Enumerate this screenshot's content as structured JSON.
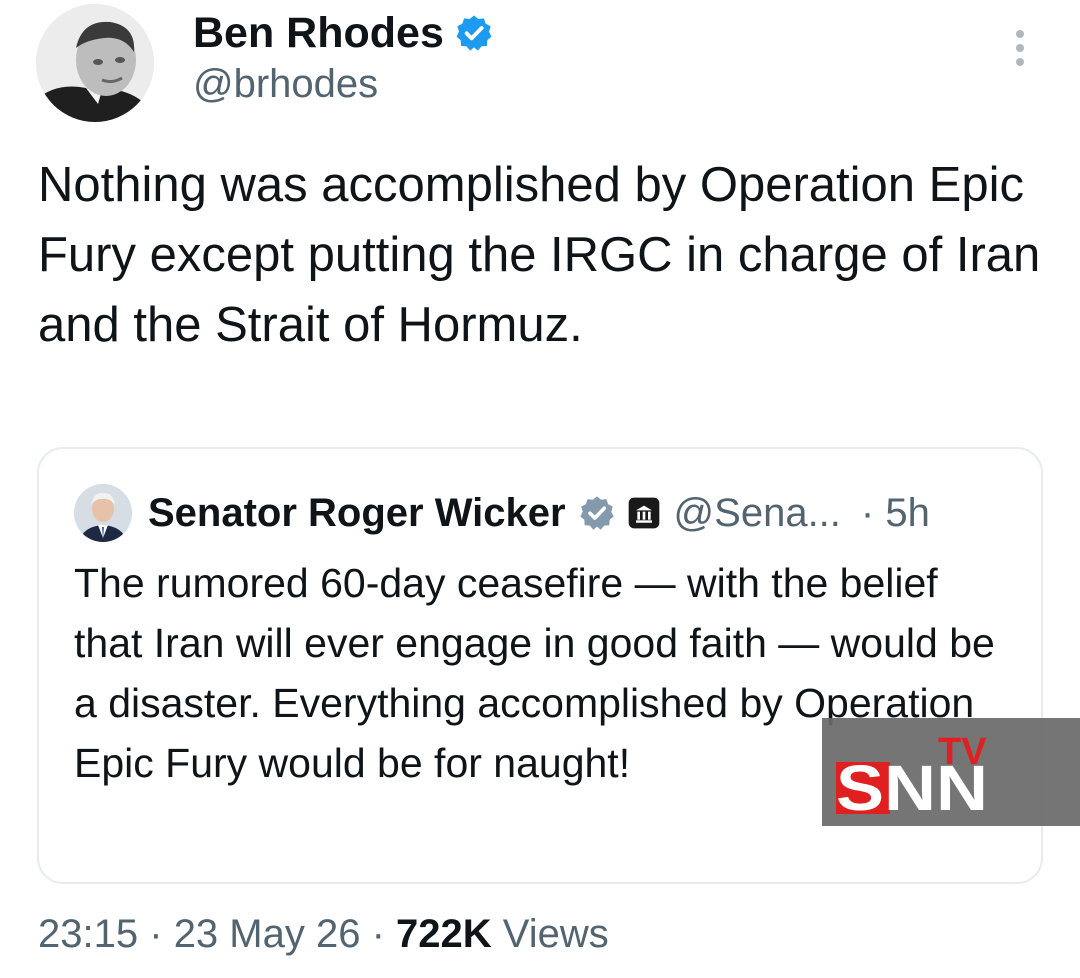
{
  "author": {
    "display_name": "Ben Rhodes",
    "handle": "@brhodes",
    "verified": true,
    "verified_color": "#1d9bf0"
  },
  "tweet": {
    "text": "Nothing was accomplished by Operation Epic Fury except putting the IRGC in charge of Iran and the Strait of Hormuz."
  },
  "quoted_tweet": {
    "display_name": "Senator Roger Wicker",
    "handle": "@Sena...",
    "time": "· 5h",
    "verified": true,
    "verified_color": "#829aab",
    "affiliation_icon": "government-building-icon",
    "text": "The rumored 60-day ceasefire — with the belief that Iran will ever engage in good faith — would be a disaster. Everything accomplished by Operation Epic Fury would be for naught!"
  },
  "meta": {
    "time": "23:15",
    "date": "23 May 26",
    "separator": "·",
    "views_count": "722K",
    "views_label": "Views"
  },
  "watermark": {
    "brand": "SNN",
    "sub": "TV",
    "brand_red": "#e02020"
  },
  "icons": {
    "more": "more-vertical-icon",
    "verified": "verified-badge-icon"
  }
}
